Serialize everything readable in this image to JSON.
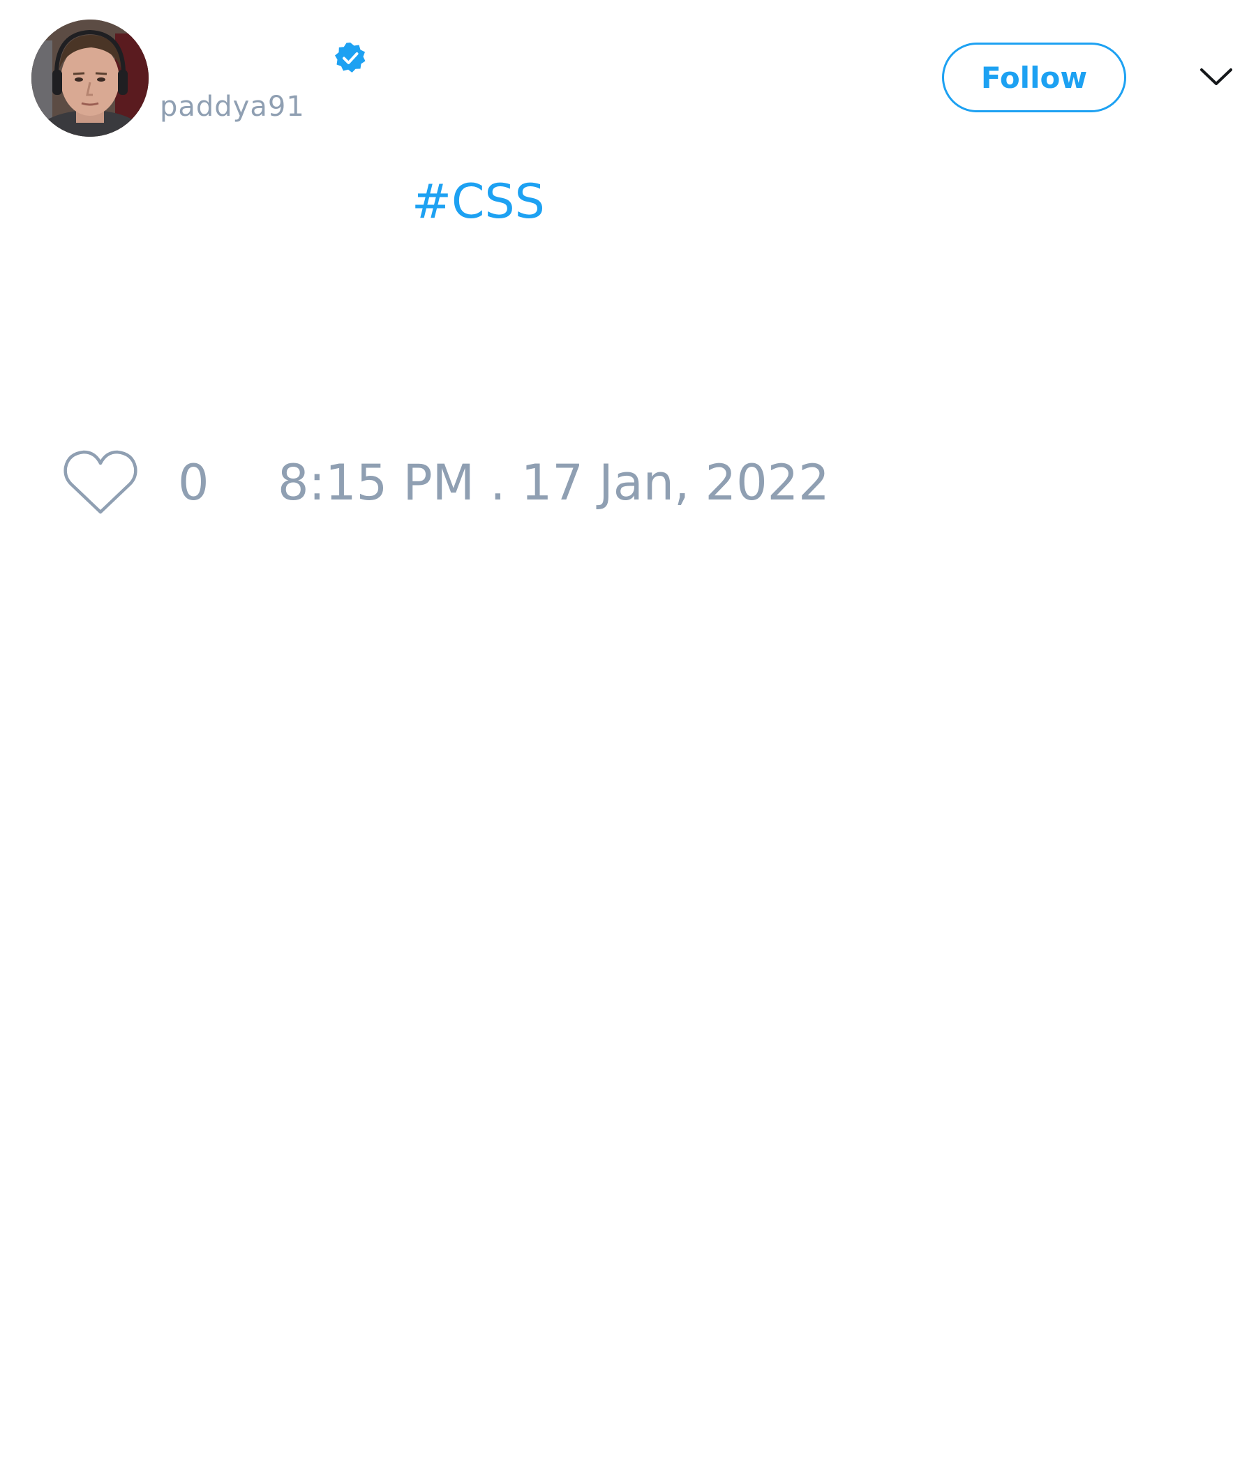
{
  "tweet": {
    "author": {
      "display_name": "",
      "username": "paddya91",
      "verified": true
    },
    "follow_label": "Follow",
    "text_before_hashtag": "",
    "hashtag": "#CSS",
    "likes": "0",
    "timestamp": "8:15 PM . 17 Jan, 2022"
  },
  "icons": {
    "avatar": "user-photo",
    "verified": "verified-badge-icon",
    "menu": "chevron-down-icon",
    "like": "heart-outline-icon"
  },
  "colors": {
    "accent": "#1da1f2",
    "muted": "#8f9fb2",
    "text": "#14171a",
    "background": "#ffffff"
  }
}
